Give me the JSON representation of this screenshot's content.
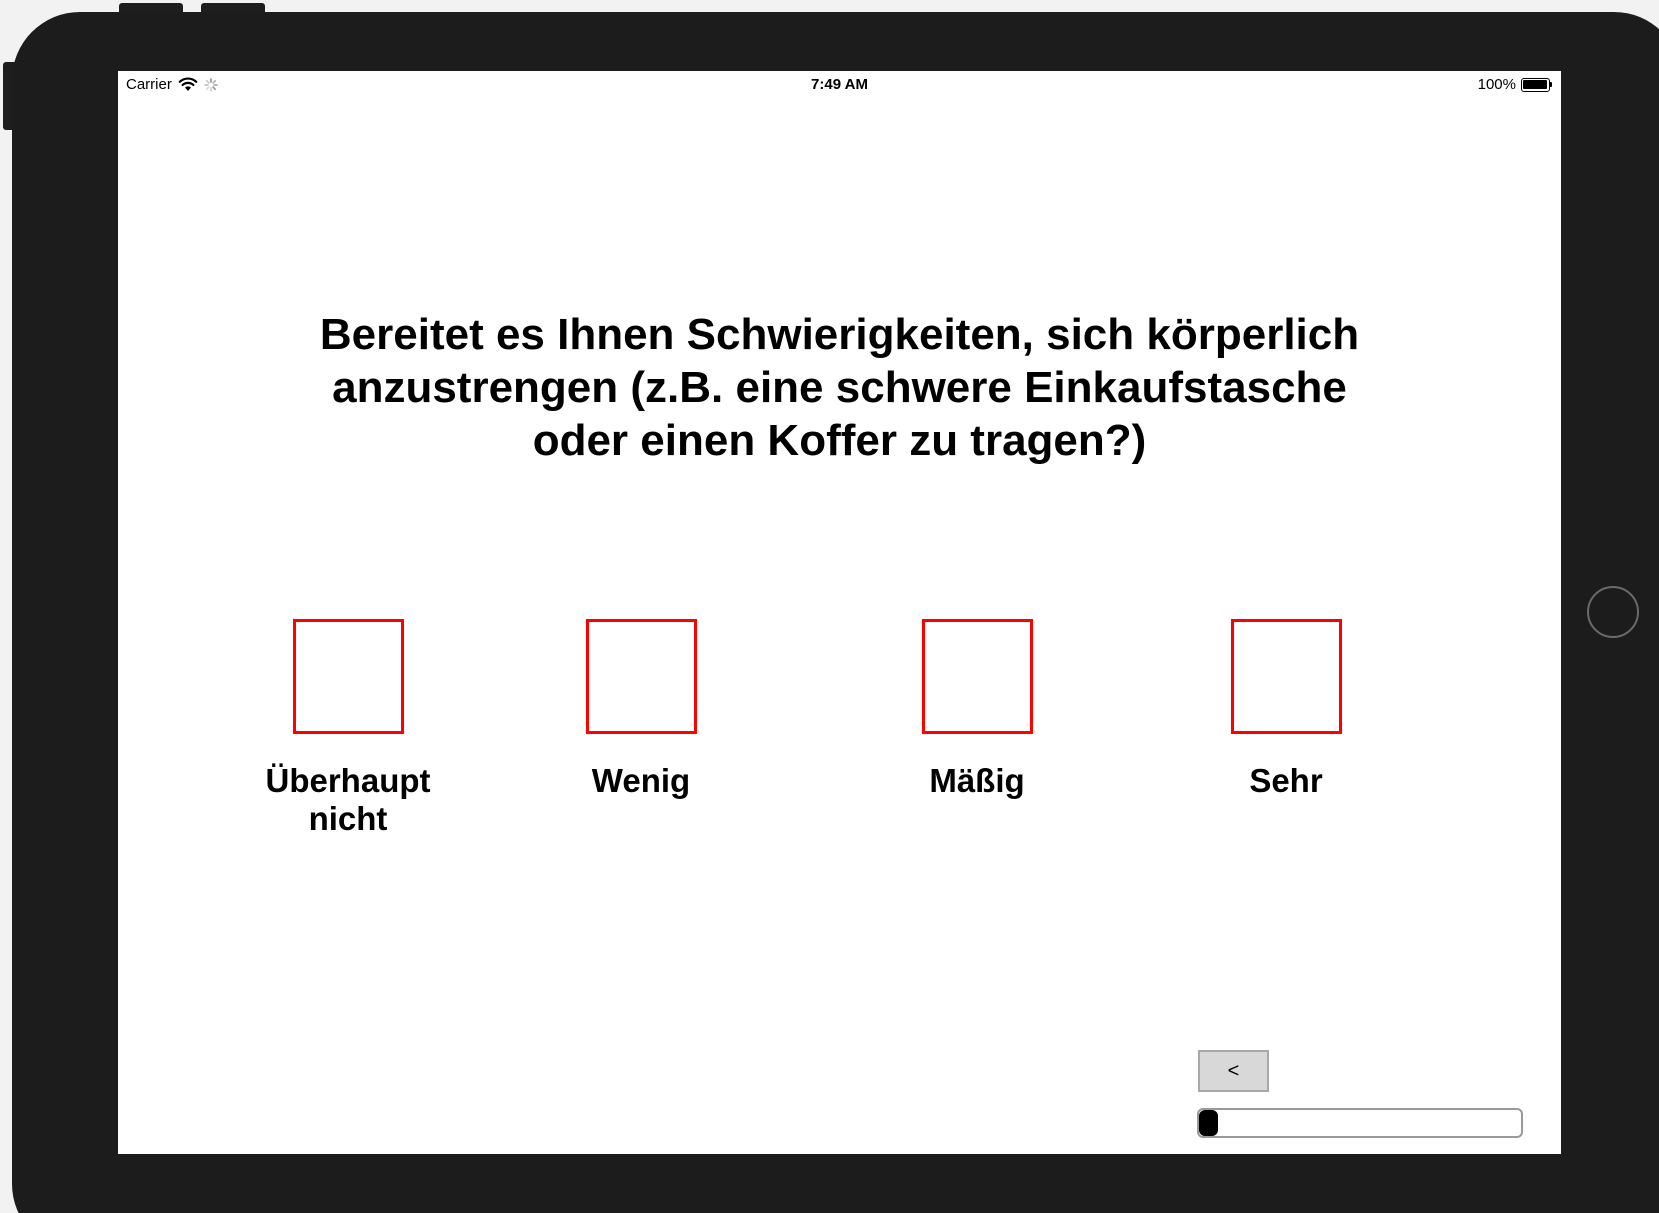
{
  "status_bar": {
    "carrier": "Carrier",
    "time": "7:49 AM",
    "battery": "100%"
  },
  "question": {
    "line1": "Bereitet es Ihnen Schwierigkeiten, sich körperlich",
    "line2": "anzustrengen (z.B. eine schwere Einkaufstasche",
    "line3": "oder einen Koffer zu tragen?)"
  },
  "options": [
    {
      "line1": "Überhaupt",
      "line2": "nicht",
      "checked": false
    },
    {
      "line1": "Wenig",
      "line2": "",
      "checked": false
    },
    {
      "line1": "Mäßig",
      "line2": "",
      "checked": false
    },
    {
      "line1": "Sehr",
      "line2": "",
      "checked": false
    }
  ],
  "navigation": {
    "back_label": "<"
  },
  "progress": {
    "fraction": 0.06
  },
  "colors": {
    "checkbox_border": "#ff0000",
    "device_frame": "#1c1c1c",
    "screen_background": "#ffffff",
    "progress_fill": "#000000"
  },
  "icons": {
    "wifi": "wifi-icon",
    "activity": "activity-spinner-icon",
    "battery": "battery-icon",
    "home": "home-button"
  }
}
